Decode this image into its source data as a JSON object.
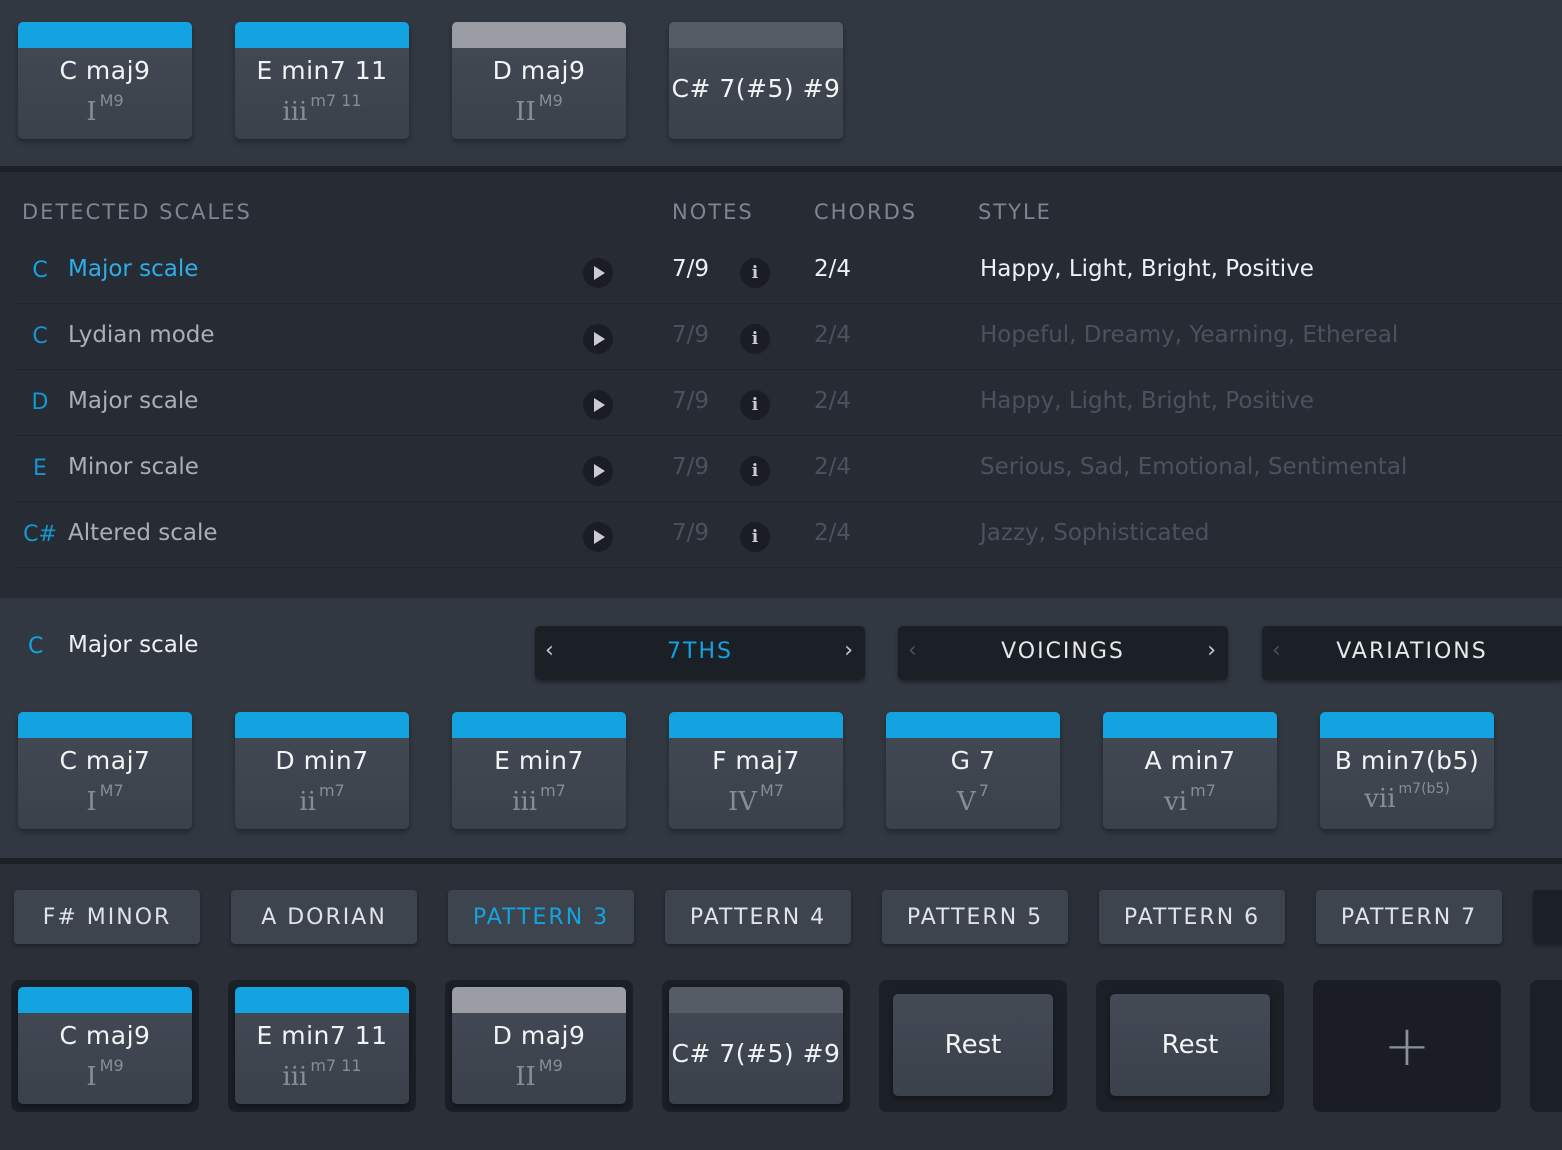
{
  "progression_top": [
    {
      "name": "C maj9",
      "roman": "I",
      "sup": "M9",
      "band": "blue"
    },
    {
      "name": "E min7 11",
      "roman": "iii",
      "sup": "m7 11",
      "band": "blue"
    },
    {
      "name": "D maj9",
      "roman": "II",
      "sup": "M9",
      "band": "grey"
    },
    {
      "name": "C# 7(#5) #9",
      "roman": "",
      "sup": "",
      "band": "dark"
    }
  ],
  "scales": {
    "headers": {
      "scales": "DETECTED SCALES",
      "notes": "NOTES",
      "chords": "CHORDS",
      "style": "STYLE"
    },
    "rows": [
      {
        "key": "C",
        "name": "Major scale",
        "notes": "7/9",
        "chords": "2/4",
        "style": "Happy, Light, Bright, Positive"
      },
      {
        "key": "C",
        "name": "Lydian mode",
        "notes": "7/9",
        "chords": "2/4",
        "style": "Hopeful, Dreamy, Yearning, Ethereal"
      },
      {
        "key": "D",
        "name": "Major scale",
        "notes": "7/9",
        "chords": "2/4",
        "style": "Happy, Light, Bright, Positive"
      },
      {
        "key": "E",
        "name": "Minor scale",
        "notes": "7/9",
        "chords": "2/4",
        "style": "Serious, Sad, Emotional, Sentimental"
      },
      {
        "key": "C#",
        "name": "Altered scale",
        "notes": "7/9",
        "chords": "2/4",
        "style": "Jazzy, Sophisticated"
      }
    ],
    "info_glyph": "i"
  },
  "selected": {
    "key": "C",
    "name": "Major scale"
  },
  "selectors": [
    {
      "label": "7THS",
      "left": "‹",
      "right": "›"
    },
    {
      "label": "VOICINGS",
      "left": "‹",
      "right": "›"
    },
    {
      "label": "VARIATIONS",
      "left": "‹",
      "right": ""
    }
  ],
  "scale_chords": [
    {
      "name": "C maj7",
      "roman": "I",
      "sup": "M7"
    },
    {
      "name": "D min7",
      "roman": "ii",
      "sup": "m7"
    },
    {
      "name": "E min7",
      "roman": "iii",
      "sup": "m7"
    },
    {
      "name": "F maj7",
      "roman": "IV",
      "sup": "M7"
    },
    {
      "name": "G 7",
      "roman": "V",
      "sup": "7"
    },
    {
      "name": "A min7",
      "roman": "vi",
      "sup": "m7"
    },
    {
      "name": "B min7(b5)",
      "roman": "vii",
      "sup": "m7(b5)"
    }
  ],
  "patterns": [
    "F# MINOR",
    "A DORIAN",
    "PATTERN 3",
    "PATTERN 4",
    "PATTERN 5",
    "PATTERN 6",
    "PATTERN 7"
  ],
  "active_pattern": "PATTERN 3",
  "sequence": {
    "chords": [
      {
        "name": "C maj9",
        "roman": "I",
        "sup": "M9",
        "band": "blue"
      },
      {
        "name": "E min7 11",
        "roman": "iii",
        "sup": "m7 11",
        "band": "blue"
      },
      {
        "name": "D maj9",
        "roman": "II",
        "sup": "M9",
        "band": "grey"
      },
      {
        "name": "C# 7(#5) #9",
        "roman": "",
        "sup": "",
        "band": "dark"
      }
    ],
    "rests": [
      "Rest",
      "Rest"
    ],
    "add_label": "+"
  },
  "colors": {
    "accent": "#13a3e0",
    "background": "#2b3038",
    "panel": "#323842",
    "card": "#3d444e"
  }
}
